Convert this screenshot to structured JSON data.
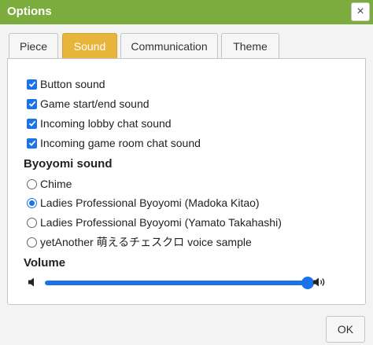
{
  "dialog": {
    "title": "Options",
    "close_symbol": "×"
  },
  "tabs": [
    {
      "label": "Piece",
      "active": false
    },
    {
      "label": "Sound",
      "active": true
    },
    {
      "label": "Communication",
      "active": false
    },
    {
      "label": "Theme",
      "active": false
    }
  ],
  "checkboxes": [
    {
      "label": "Button sound",
      "checked": true
    },
    {
      "label": "Game start/end sound",
      "checked": true
    },
    {
      "label": "Incoming lobby chat sound",
      "checked": true
    },
    {
      "label": "Incoming game room chat sound",
      "checked": true
    }
  ],
  "byoyomi": {
    "heading": "Byoyomi sound",
    "options": [
      {
        "label": "Chime",
        "selected": false
      },
      {
        "label": "Ladies Professional Byoyomi (Madoka Kitao)",
        "selected": true
      },
      {
        "label": "Ladies Professional Byoyomi (Yamato Takahashi)",
        "selected": false
      },
      {
        "label": "yetAnother 萌えるチェスクロ voice sample",
        "selected": false
      }
    ]
  },
  "volume": {
    "heading": "Volume",
    "level_percent": 100,
    "low_icon": "speaker-low-icon",
    "high_icon": "speaker-high-icon"
  },
  "footer": {
    "ok_label": "OK"
  },
  "colors": {
    "titlebar": "#7dac3e",
    "active_tab": "#e8b53c",
    "accent": "#1a73e8"
  }
}
